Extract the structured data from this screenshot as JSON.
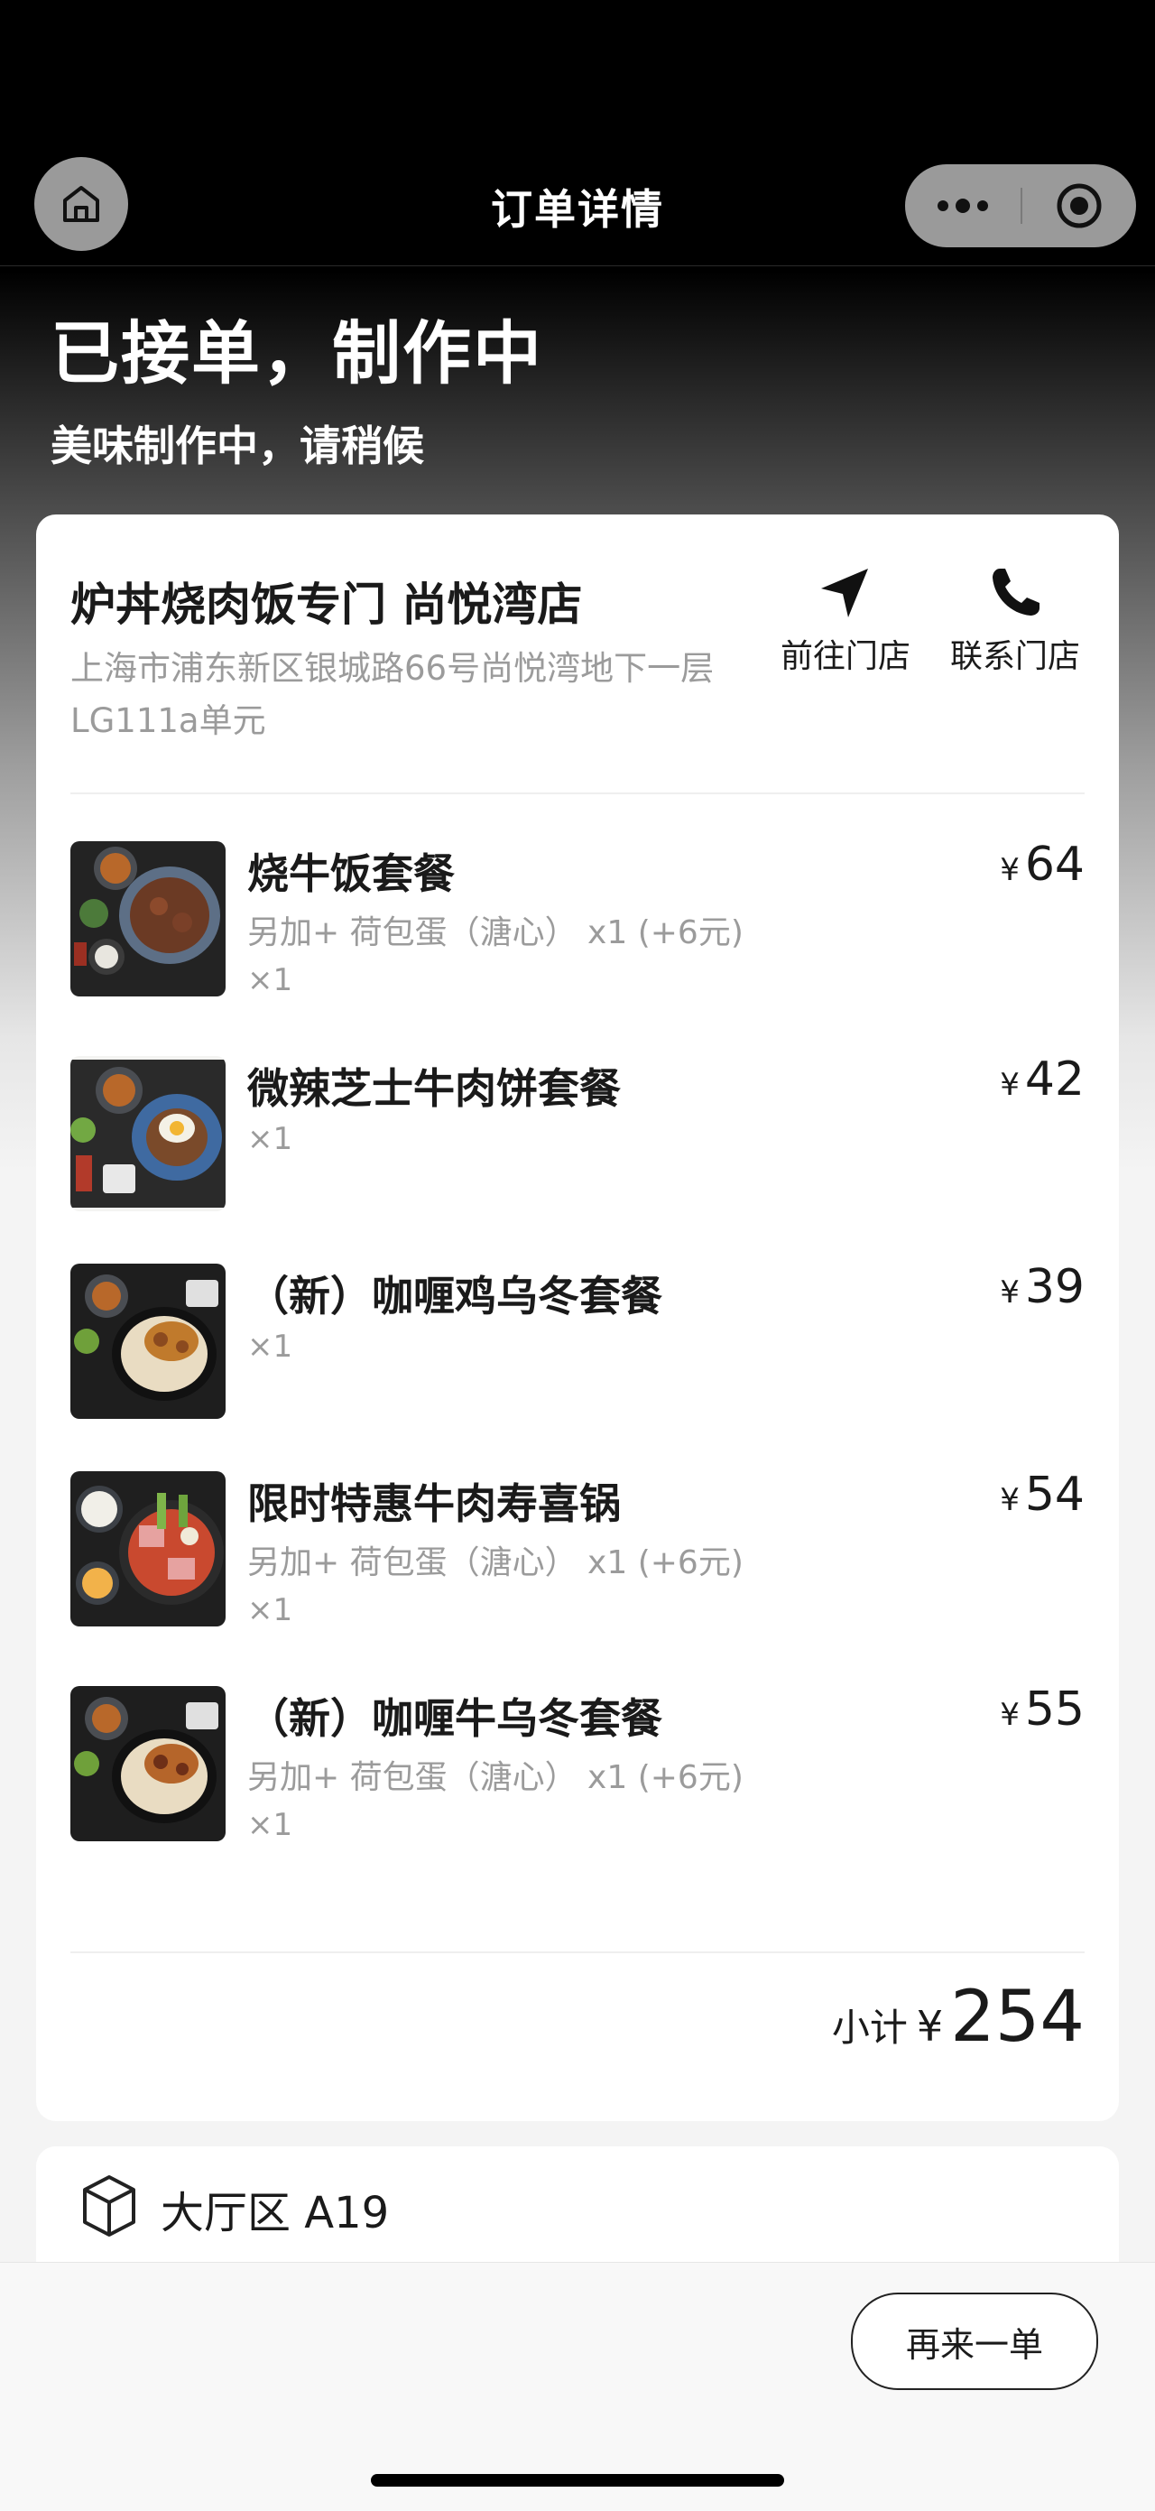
{
  "nav": {
    "title": "订单详情",
    "home_icon": "home-icon",
    "more_icon": "more-dots-icon",
    "close_icon": "target-circle-icon"
  },
  "status": {
    "title": "已接单，制作中",
    "subtitle": "美味制作中，请稍候"
  },
  "store": {
    "name": "炉丼烧肉饭专门 尚悦湾店",
    "address": "上海市浦东新区银城路66号尚悦湾地下一层LG111a单元",
    "navigate_label": "前往门店",
    "call_label": "联系门店"
  },
  "items": [
    {
      "name": "烧牛饭套餐",
      "option": "另加+ 荷包蛋（溏心） x1 (+6元)",
      "qty": "×1",
      "currency": "¥",
      "price": "64"
    },
    {
      "name": "微辣芝士牛肉饼套餐",
      "option": "",
      "qty": "×1",
      "currency": "¥",
      "price": "42"
    },
    {
      "name": "（新）咖喱鸡乌冬套餐",
      "option": "",
      "qty": "×1",
      "currency": "¥",
      "price": "39"
    },
    {
      "name": "限时特惠牛肉寿喜锅",
      "option": "另加+ 荷包蛋（溏心） x1 (+6元)",
      "qty": "×1",
      "currency": "¥",
      "price": "54"
    },
    {
      "name": "（新）咖喱牛乌冬套餐",
      "option": "另加+ 荷包蛋（溏心） x1 (+6元)",
      "qty": "×1",
      "currency": "¥",
      "price": "55"
    }
  ],
  "subtotal": {
    "label": "小计",
    "currency": "¥",
    "amount": "254"
  },
  "table": {
    "label": "大厅区 A19",
    "icon": "cube-icon"
  },
  "actions": {
    "reorder_label": "再来一单"
  }
}
